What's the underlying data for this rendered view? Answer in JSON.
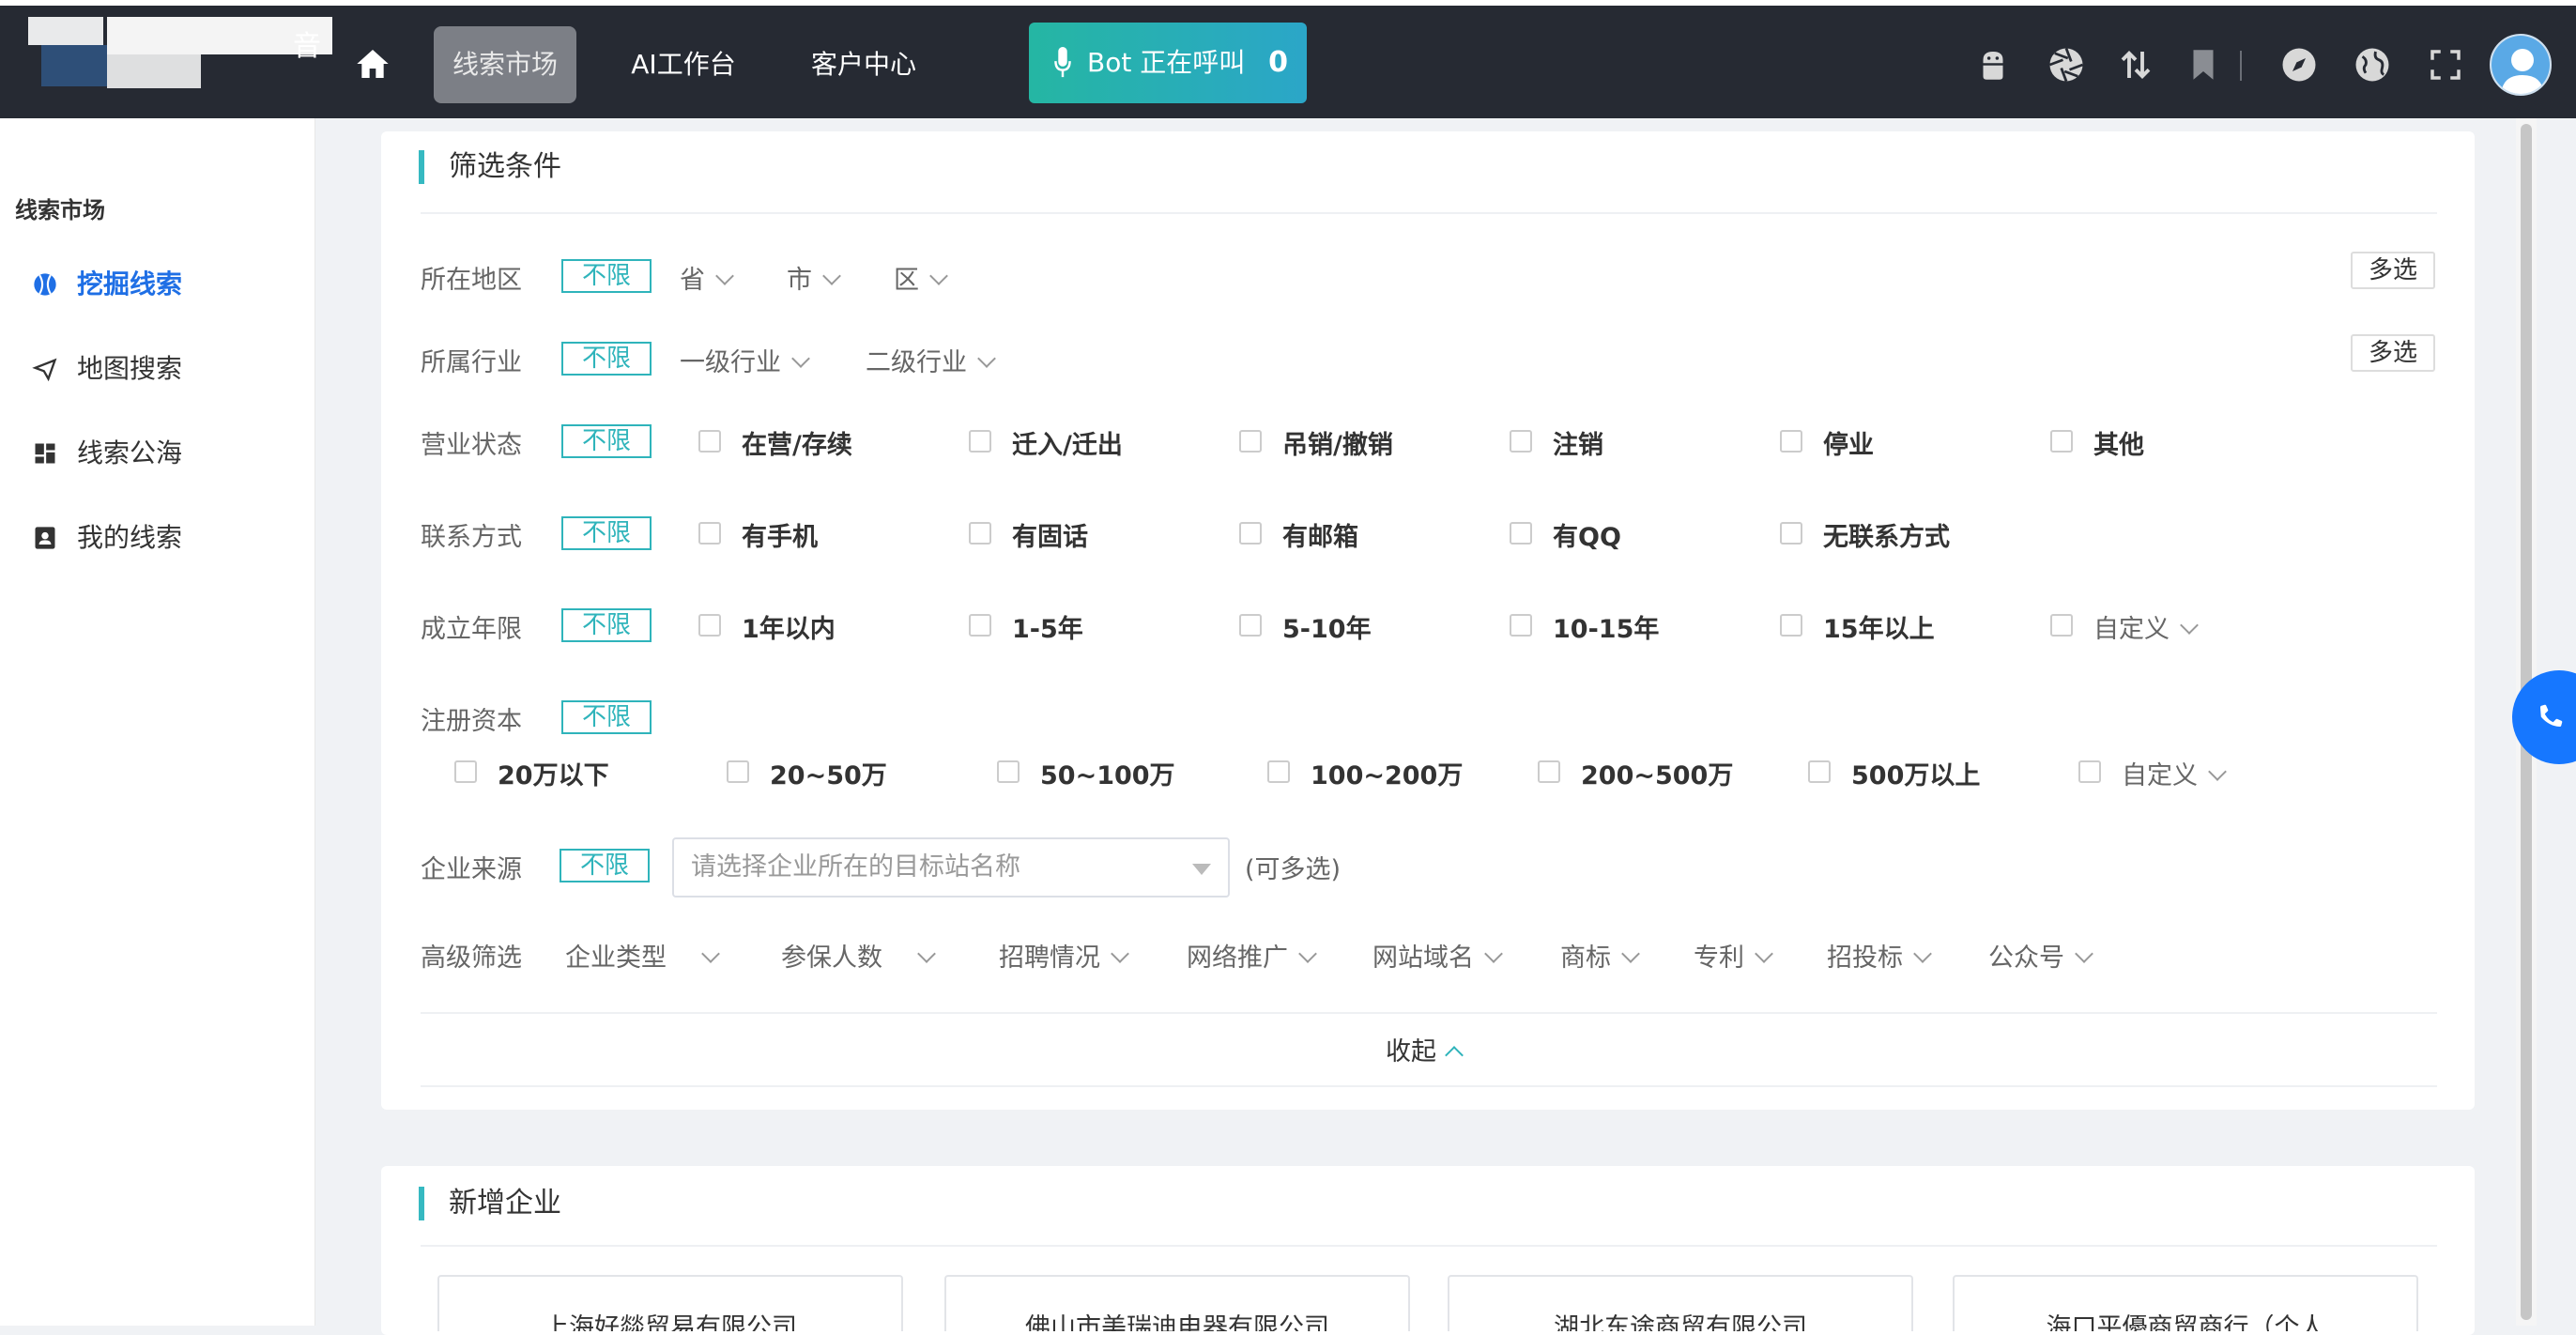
{
  "header": {
    "logo_char": "音",
    "nav": [
      {
        "label": "线索市场",
        "active": true
      },
      {
        "label": "AI工作台",
        "active": false
      },
      {
        "label": "客户中心",
        "active": false
      }
    ],
    "bot_button": {
      "label": "Bot 正在呼叫",
      "count": "0"
    },
    "right_icons": [
      "android-icon",
      "aperture-icon",
      "transfer-icon",
      "bookmark-icon",
      "compass-icon",
      "globe-icon",
      "fullscreen-icon"
    ]
  },
  "sidebar": {
    "title": "线索市场",
    "items": [
      {
        "label": "挖掘线索",
        "icon": "tennis-ball-icon",
        "active": true
      },
      {
        "label": "地图搜索",
        "icon": "send-icon",
        "active": false
      },
      {
        "label": "线索公海",
        "icon": "dashboard-icon",
        "active": false
      },
      {
        "label": "我的线索",
        "icon": "contact-card-icon",
        "active": false
      }
    ]
  },
  "filters": {
    "title": "筛选条件",
    "unlimited": "不限",
    "multi_select": "多选",
    "region": {
      "label": "所在地区",
      "dropdowns": [
        "省",
        "市",
        "区"
      ]
    },
    "industry": {
      "label": "所属行业",
      "dropdowns": [
        "一级行业",
        "二级行业"
      ]
    },
    "status": {
      "label": "营业状态",
      "options": [
        "在营/存续",
        "迁入/迁出",
        "吊销/撤销",
        "注销",
        "停业",
        "其他"
      ]
    },
    "contact": {
      "label": "联系方式",
      "options": [
        "有手机",
        "有固话",
        "有邮箱",
        "有QQ",
        "无联系方式"
      ]
    },
    "age": {
      "label": "成立年限",
      "options": [
        "1年以内",
        "1-5年",
        "5-10年",
        "10-15年",
        "15年以上"
      ],
      "custom": "自定义"
    },
    "capital": {
      "label": "注册资本",
      "options": [
        "20万以下",
        "20~50万",
        "50~100万",
        "100~200万",
        "200~500万",
        "500万以上"
      ],
      "custom": "自定义"
    },
    "source": {
      "label": "企业来源",
      "placeholder": "请选择企业所在的目标站名称",
      "hint": "(可多选)"
    },
    "advanced": {
      "label": "高级筛选",
      "dropdowns": [
        "企业类型",
        "参保人数",
        "招聘情况",
        "网络推广",
        "网站域名",
        "商标",
        "专利",
        "招投标",
        "公众号"
      ]
    },
    "collapse": "收起"
  },
  "new_companies": {
    "title": "新增企业",
    "items": [
      "上海好燚贸易有限公司",
      "佛山市美瑞迪电器有限公司",
      "湖北东途商贸有限公司",
      "海口平優商贸商行（个人"
    ]
  },
  "colors": {
    "accent": "#2fb4bb",
    "active_blue": "#1f6fe5",
    "topbar": "#262a33"
  }
}
